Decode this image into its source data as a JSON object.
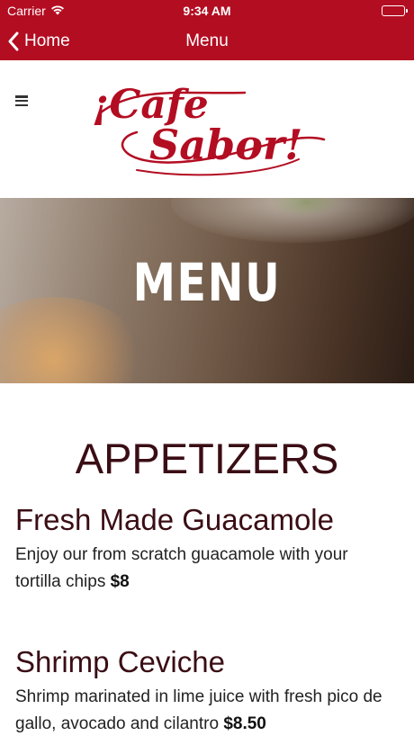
{
  "status_bar": {
    "carrier": "Carrier",
    "time": "9:34 AM",
    "wifi_icon": "wifi-icon",
    "battery_icon": "battery-icon"
  },
  "nav_bar": {
    "back_label": "Home",
    "title": "Menu",
    "background": "#b30d22"
  },
  "header": {
    "menu_icon": "hamburger-menu-icon",
    "logo_text_line1": "¡Cafe",
    "logo_text_line2": "Sabor!",
    "logo_color": "#b30d22"
  },
  "hero": {
    "title": "MENU"
  },
  "menu": {
    "section_title": "APPETIZERS",
    "items": [
      {
        "name": "Fresh Made Guacamole",
        "description": "Enjoy our from scratch guacamole with your tortilla chips",
        "price": "$8"
      },
      {
        "name": "Shrimp Ceviche",
        "description": "Shrimp marinated in lime juice with fresh pico de gallo, avocado and cilantro",
        "price": "$8.50"
      }
    ]
  }
}
